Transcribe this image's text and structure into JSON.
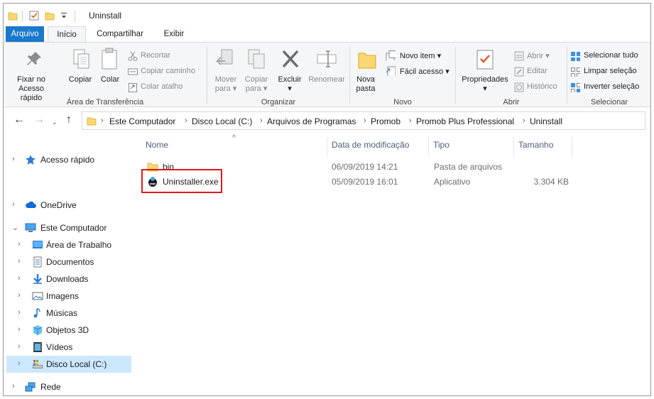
{
  "window": {
    "title": "Uninstall"
  },
  "tabs": [
    {
      "label": "Arquivo"
    },
    {
      "label": "Início"
    },
    {
      "label": "Compartilhar"
    },
    {
      "label": "Exibir"
    }
  ],
  "ribbon": {
    "clipboard": {
      "group": "Área de Transferência",
      "pin": "Fixar no\nAcesso rápido",
      "copy": "Copiar",
      "paste": "Colar",
      "cut": "Recortar",
      "copy_path": "Copiar caminho",
      "paste_shortcut": "Colar atalho"
    },
    "organize": {
      "group": "Organizar",
      "move": "Mover\npara ▾",
      "copy_to": "Copiar\npara ▾",
      "delete": "Excluir\n▾",
      "rename": "Renomear"
    },
    "new": {
      "group": "Novo",
      "new_folder": "Nova\npasta",
      "new_item": "Novo item ▾",
      "easy_access": "Fácil acesso ▾"
    },
    "open": {
      "group": "Abrir",
      "properties": "Propriedades\n▾",
      "open": "Abrir ▾",
      "edit": "Editar",
      "history": "Histórico"
    },
    "select": {
      "group": "Selecionar",
      "select_all": "Selecionar tudo",
      "select_none": "Limpar seleção",
      "invert": "Inverter seleção"
    }
  },
  "address": {
    "crumbs": [
      "Este Computador",
      "Disco Local (C:)",
      "Arquivos de Programas",
      "Promob",
      "Promob Plus Professional",
      "Uninstall"
    ]
  },
  "nav": {
    "quick_access": "Acesso rápido",
    "onedrive": "OneDrive",
    "this_pc": "Este Computador",
    "desktop": "Área de Trabalho",
    "documents": "Documentos",
    "downloads": "Downloads",
    "pictures": "Imagens",
    "music": "Músicas",
    "objects3d": "Objetos 3D",
    "videos": "Vídeos",
    "local_disk": "Disco Local (C:)",
    "network": "Rede"
  },
  "columns": {
    "name": "Nome",
    "modified": "Data de modificação",
    "type": "Tipo",
    "size": "Tamanho"
  },
  "files": [
    {
      "name": "bin",
      "modified": "06/09/2019 14:21",
      "type": "Pasta de arquivos",
      "size": ""
    },
    {
      "name": "Uninstaller.exe",
      "modified": "05/09/2019 16:01",
      "type": "Aplicativo",
      "size": "3.304 KB"
    }
  ],
  "colors": {
    "accent": "#1979ca",
    "selection": "#cce8ff",
    "highlight_box": "#e0191d",
    "folder": "#f8d775"
  }
}
